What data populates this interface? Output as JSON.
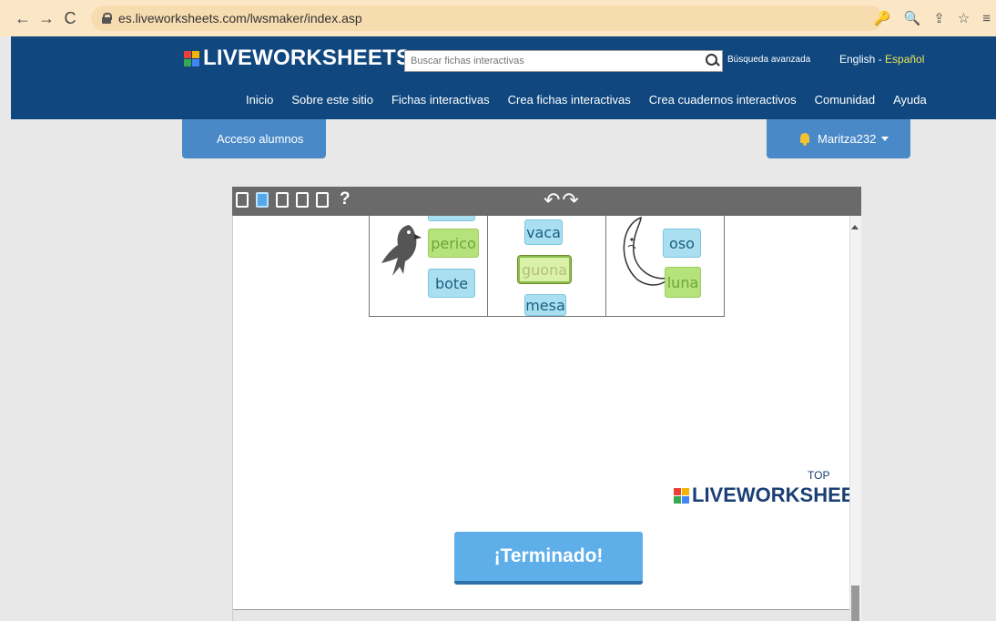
{
  "browser": {
    "url": "es.liveworksheets.com/lwsmaker/index.asp",
    "back_icon": "←",
    "forward_icon": "→",
    "reload_icon": "C",
    "right_icons": [
      "🔑",
      "🔍",
      "⇪",
      "☆",
      "≡"
    ]
  },
  "header": {
    "logo_text": "LIVEWORKSHEETS",
    "search_placeholder": "Buscar fichas interactivas",
    "advanced_search": "Búsqueda avanzada",
    "lang_english": "English",
    "lang_sep": " - ",
    "lang_spanish": "Español",
    "nav": [
      "Inicio",
      "Sobre este sitio",
      "Fichas interactivas",
      "Crea fichas interactivas",
      "Crea cuadernos interactivos",
      "Comunidad",
      "Ayuda"
    ]
  },
  "tabs": {
    "students": "Acceso alumnos",
    "user": "Maritza232"
  },
  "toolbar": {
    "help": "?",
    "undo_redo": "↶↷"
  },
  "worksheet": {
    "words": [
      "perico",
      "bote",
      "vaca",
      "guona",
      "mesa",
      "oso",
      "luna"
    ]
  },
  "watermark": {
    "text": "LIVEWORKSHEETS",
    "top": "TOP"
  },
  "finish_button": "¡Terminado!",
  "colors": {
    "header": "#0f477e",
    "tab": "#4a89c8",
    "finish": "#5eaeea",
    "logo_mark": [
      "#e94235",
      "#f4b400",
      "#34a853",
      "#4285f4"
    ]
  }
}
